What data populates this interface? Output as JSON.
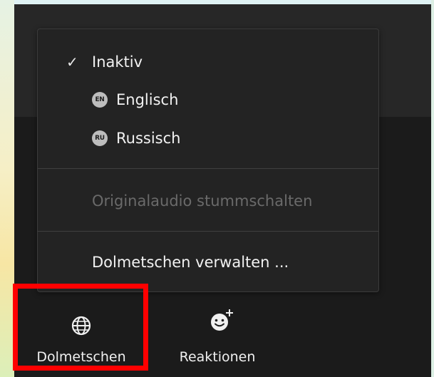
{
  "menu": {
    "items": [
      {
        "label": "Inaktiv",
        "checked": true
      },
      {
        "label": "Englisch",
        "badge": "EN"
      },
      {
        "label": "Russisch",
        "badge": "RU"
      }
    ],
    "mute_original": "Originalaudio stummschalten",
    "manage": "Dolmetschen verwalten ..."
  },
  "toolbar": {
    "interpretation_label": "Dolmetschen",
    "reactions_label": "Reaktionen",
    "interpretation_icon": "globe-icon",
    "reactions_icon": "emoji-add-icon"
  },
  "colors": {
    "highlight": "#ff0000",
    "menu_bg": "#232323",
    "app_bg": "#1b1b1b",
    "disabled_text": "#6a6a6a"
  }
}
